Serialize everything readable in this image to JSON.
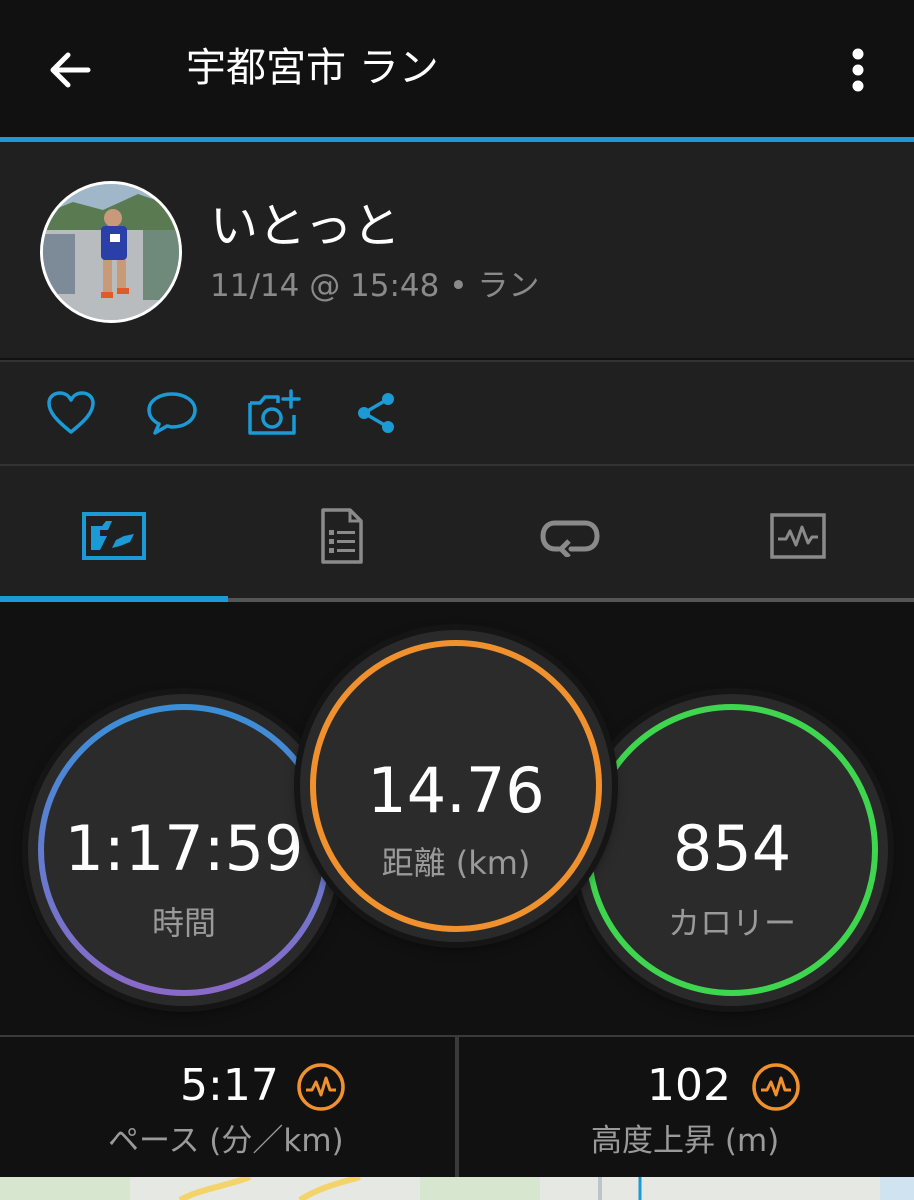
{
  "header": {
    "title": "宇都宮市 ラン",
    "back_icon": "arrow-left-icon",
    "menu_icon": "more-vertical-icon"
  },
  "profile": {
    "username": "いとっと",
    "meta": "11/14 @ 15:48 • ラン"
  },
  "actions": [
    {
      "icon": "heart-icon"
    },
    {
      "icon": "comment-icon"
    },
    {
      "icon": "add-photo-icon"
    },
    {
      "icon": "share-icon"
    }
  ],
  "tabs": [
    {
      "icon": "overview-map-icon",
      "selected": true
    },
    {
      "icon": "details-document-icon",
      "selected": false
    },
    {
      "icon": "laps-loop-icon",
      "selected": false
    },
    {
      "icon": "charts-icon",
      "selected": false
    }
  ],
  "stats": {
    "time": {
      "value": "1:17:59",
      "label": "時間"
    },
    "distance": {
      "value": "14.76",
      "label": "距離 (km)"
    },
    "calories": {
      "value": "854",
      "label": "カロリー"
    }
  },
  "metrics": {
    "pace": {
      "value": "5:17",
      "label": "ペース (分／km)"
    },
    "elevation": {
      "value": "102",
      "label": "高度上昇 (m)"
    }
  },
  "colors": {
    "accent": "#1b9ad6",
    "time_ring_start": "#3a8fd8",
    "time_ring_end": "#8a6ac8",
    "distance_ring": "#f0912e",
    "calories_ring": "#3fd64f",
    "metric_icon": "#f0912e"
  }
}
